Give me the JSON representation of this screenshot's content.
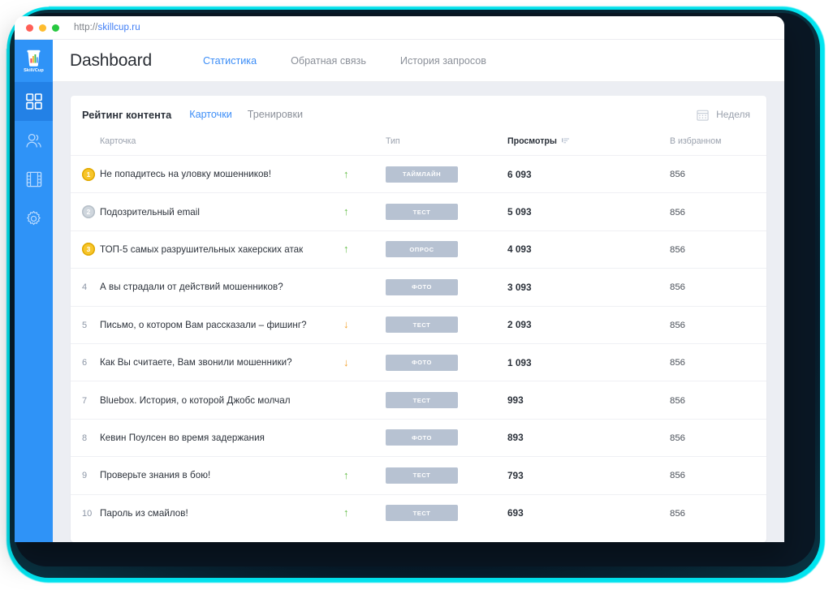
{
  "browser": {
    "url_scheme": "http://",
    "url_host": "skillcup.ru",
    "traffic_lights": [
      "close-dot",
      "minimize-dot",
      "maximize-dot"
    ]
  },
  "sidebar": {
    "logo": {
      "icon": "coffee-cup-chart-icon",
      "label": "Skill/Cup"
    },
    "items": [
      {
        "icon": "grid-dashboard-icon",
        "name": "dashboard",
        "active": true
      },
      {
        "icon": "users-icon",
        "name": "users",
        "active": false
      },
      {
        "icon": "film-media-icon",
        "name": "media",
        "active": false
      },
      {
        "icon": "gear-settings-icon",
        "name": "settings",
        "active": false
      }
    ]
  },
  "header": {
    "title": "Dashboard",
    "tabs": [
      {
        "label": "Статистика",
        "active": true
      },
      {
        "label": "Обратная связь",
        "active": false
      },
      {
        "label": "История запросов",
        "active": false
      }
    ]
  },
  "panel": {
    "title": "Рейтинг контента",
    "tabs": [
      {
        "label": "Карточки",
        "active": true
      },
      {
        "label": "Тренировки",
        "active": false
      }
    ],
    "period": {
      "icon": "calendar-icon",
      "label": "Неделя"
    }
  },
  "table": {
    "columns": [
      {
        "key": "rank",
        "label": ""
      },
      {
        "key": "name",
        "label": "Карточка",
        "sorted": false
      },
      {
        "key": "trend",
        "label": ""
      },
      {
        "key": "type",
        "label": "Тип",
        "sorted": false
      },
      {
        "key": "views",
        "label": "Просмотры",
        "sorted": true,
        "sort_icon": "sort-descending-icon"
      },
      {
        "key": "fav",
        "label": "В избранном",
        "sorted": false
      }
    ],
    "rows": [
      {
        "rank": "1",
        "medal": "gold",
        "name": "Не попадитесь на уловку мошенников!",
        "trend": "up",
        "type": "ТАЙМЛАЙН",
        "views": "6 093",
        "fav": "856"
      },
      {
        "rank": "2",
        "medal": "silver",
        "name": "Подозрительный email",
        "trend": "up",
        "type": "ТЕСТ",
        "views": "5 093",
        "fav": "856"
      },
      {
        "rank": "3",
        "medal": "gold",
        "name": "ТОП-5 самых разрушительных хакерских атак",
        "trend": "up",
        "type": "ОПРОС",
        "views": "4 093",
        "fav": "856"
      },
      {
        "rank": "4",
        "medal": "none",
        "name": "А вы страдали от действий мошенников?",
        "trend": "none",
        "type": "ФОТО",
        "views": "3 093",
        "fav": "856"
      },
      {
        "rank": "5",
        "medal": "none",
        "name": "Письмо, о котором Вам рассказали – фишинг?",
        "trend": "down",
        "type": "ТЕСТ",
        "views": "2 093",
        "fav": "856"
      },
      {
        "rank": "6",
        "medal": "none",
        "name": "Как Вы считаете, Вам звонили мошенники?",
        "trend": "down",
        "type": "ФОТО",
        "views": "1 093",
        "fav": "856"
      },
      {
        "rank": "7",
        "medal": "none",
        "name": "Bluebox. История, о которой Джобс молчал",
        "trend": "none",
        "type": "ТЕСТ",
        "views": "993",
        "fav": "856"
      },
      {
        "rank": "8",
        "medal": "none",
        "name": "Кевин Поулсен во время задержания",
        "trend": "none",
        "type": "ФОТО",
        "views": "893",
        "fav": "856"
      },
      {
        "rank": "9",
        "medal": "none",
        "name": "Проверьте знания в бою!",
        "trend": "up",
        "type": "ТЕСТ",
        "views": "793",
        "fav": "856"
      },
      {
        "rank": "10",
        "medal": "none",
        "name": "Пароль из смайлов!",
        "trend": "up",
        "type": "ТЕСТ",
        "views": "693",
        "fav": "856"
      }
    ]
  },
  "colors": {
    "brand_blue": "#2f93f7",
    "link_blue": "#3d8ef7",
    "trend_up": "#62bd45",
    "trend_down": "#f2a02b",
    "badge_bg": "#b7c2d2",
    "medal_gold": "#f7c52a",
    "medal_silver": "#cfd6dd",
    "frame_cyan": "#00e5f0",
    "frame_dark": "#0a1724",
    "page_bg": "#eceef3"
  }
}
